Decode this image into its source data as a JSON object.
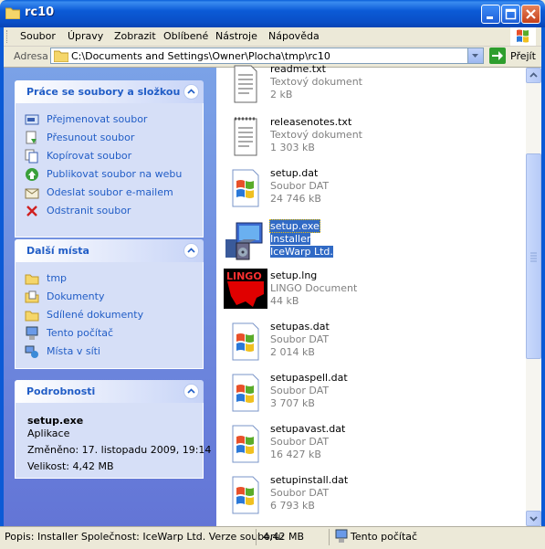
{
  "window": {
    "title": "rc10"
  },
  "menu": [
    "Soubor",
    "Úpravy",
    "Zobrazit",
    "Oblíbené",
    "Nástroje",
    "Nápověda"
  ],
  "address": {
    "label": "Adresa",
    "path": "C:\\Documents and Settings\\Owner\\Plocha\\tmp\\rc10",
    "go_label": "Přejít"
  },
  "tasks_panel": {
    "title": "Práce se soubory a složkou",
    "items": [
      {
        "label": "Přejmenovat soubor",
        "icon": "rename-icon"
      },
      {
        "label": "Přesunout soubor",
        "icon": "move-icon"
      },
      {
        "label": "Kopírovat soubor",
        "icon": "copy-icon"
      },
      {
        "label": "Publikovat soubor na webu",
        "icon": "publish-web-icon"
      },
      {
        "label": "Odeslat soubor e-mailem",
        "icon": "email-icon"
      },
      {
        "label": "Odstranit soubor",
        "icon": "delete-icon"
      }
    ]
  },
  "places_panel": {
    "title": "Další místa",
    "items": [
      {
        "label": "tmp",
        "icon": "folder-icon"
      },
      {
        "label": "Dokumenty",
        "icon": "documents-icon"
      },
      {
        "label": "Sdílené dokumenty",
        "icon": "shared-folder-icon"
      },
      {
        "label": "Tento počítač",
        "icon": "computer-icon"
      },
      {
        "label": "Místa v síti",
        "icon": "network-icon"
      }
    ]
  },
  "details_panel": {
    "title": "Podrobnosti",
    "name": "setup.exe",
    "type": "Aplikace",
    "modified": "Změněno: 17. listopadu 2009, 19:14",
    "size": "Velikost: 4,42 MB"
  },
  "files": [
    {
      "name": "readme.txt",
      "type": "Textový dokument",
      "size": "2 kB",
      "icon": "text-document-icon",
      "selected": false
    },
    {
      "name": "releasenotes.txt",
      "type": "Textový dokument",
      "size": "1 303 kB",
      "icon": "text-document-icon",
      "selected": false
    },
    {
      "name": "setup.dat",
      "type": "Soubor DAT",
      "size": "24 746 kB",
      "icon": "windows-file-icon",
      "selected": false
    },
    {
      "name": "setup.exe",
      "type": "Installer",
      "size": "IceWarp Ltd.",
      "icon": "installer-icon",
      "selected": true
    },
    {
      "name": "setup.lng",
      "type": "LINGO Document",
      "size": "44 kB",
      "icon": "lingo-icon",
      "selected": false
    },
    {
      "name": "setupas.dat",
      "type": "Soubor DAT",
      "size": "2 014 kB",
      "icon": "windows-file-icon",
      "selected": false
    },
    {
      "name": "setupaspell.dat",
      "type": "Soubor DAT",
      "size": "3 707 kB",
      "icon": "windows-file-icon",
      "selected": false
    },
    {
      "name": "setupavast.dat",
      "type": "Soubor DAT",
      "size": "16 427 kB",
      "icon": "windows-file-icon",
      "selected": false
    },
    {
      "name": "setupinstall.dat",
      "type": "Soubor DAT",
      "size": "6 793 kB",
      "icon": "windows-file-icon",
      "selected": false
    }
  ],
  "status": {
    "description": "Popis: Installer Společnost: IceWarp Ltd. Verze souboru:",
    "size": "4,42 MB",
    "zone": "Tento počítač"
  }
}
